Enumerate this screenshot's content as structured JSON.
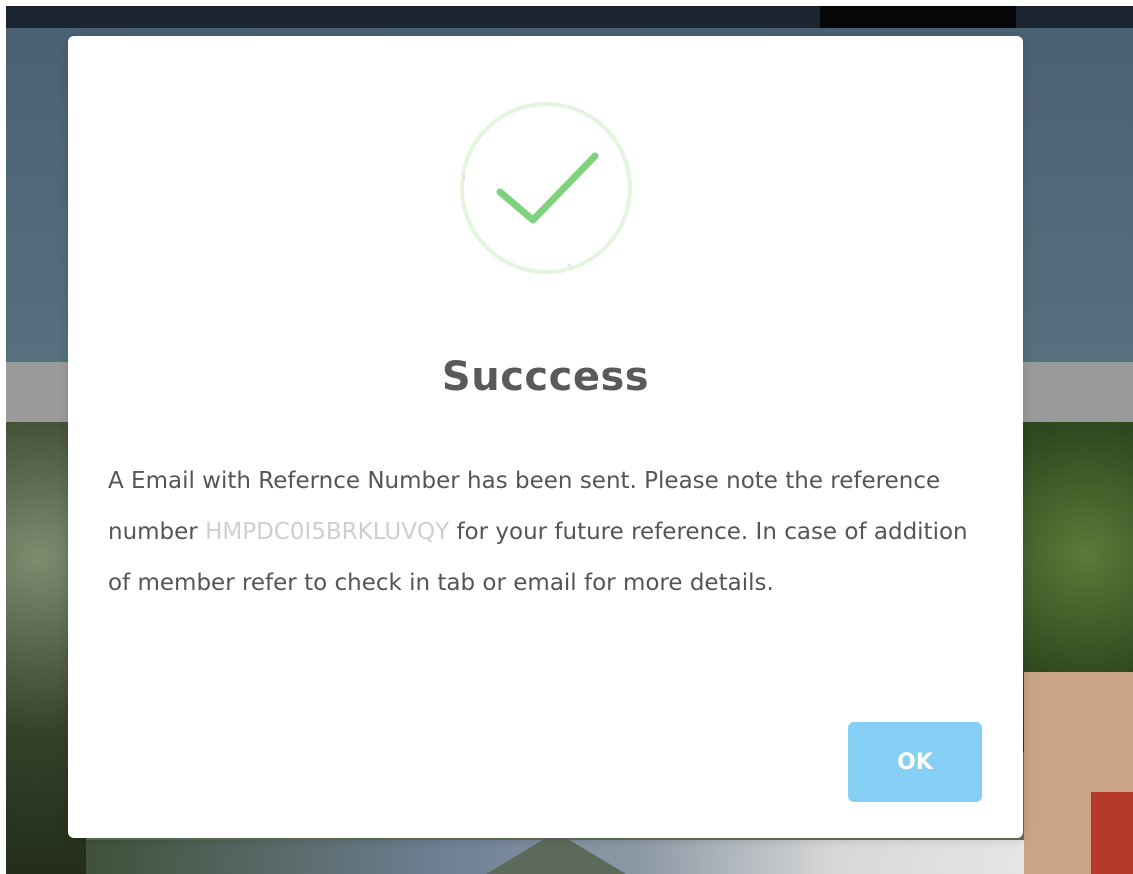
{
  "modal": {
    "icon": "checkmark-circle-icon",
    "title": "Succcess",
    "message_part1": "A Email with Refernce Number has been sent. Please note the reference number",
    "reference_number": "HMPDC0I5BRKLUVQY",
    "message_part2": "for your future reference. In case of addition of member refer to check in tab or email for more details.",
    "ok_label": "OK"
  },
  "colors": {
    "success_green": "#7ed27b",
    "ring_green": "#e3f4df",
    "ok_button": "#86cff4",
    "title": "#5a5a5a",
    "text": "#555555"
  }
}
